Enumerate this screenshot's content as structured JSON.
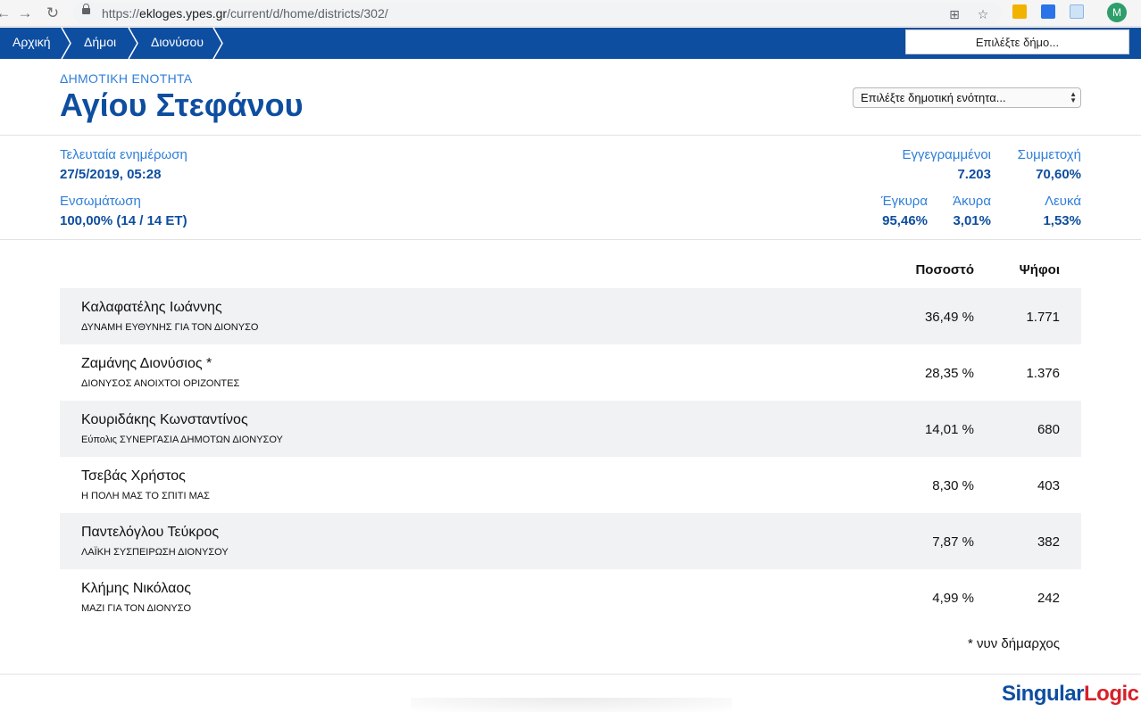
{
  "browser": {
    "url_scheme": "https://",
    "url_host": "ekloges.ypes.gr",
    "url_path": "/current/d/home/districts/302/",
    "avatar_letter": "M"
  },
  "breadcrumb": {
    "items": [
      "Αρχική",
      "Δήμοι",
      "Διονύσου"
    ]
  },
  "municipality_select": {
    "value": "Επιλέξτε δήμο..."
  },
  "header": {
    "unit_type": "Δημοτική Ενότητα",
    "unit_name": "Αγίου Στεφάνου",
    "unit_select_value": "Επιλέξτε δημοτική ενότητα..."
  },
  "stats": {
    "last_update_label": "Τελευταία ενημέρωση",
    "last_update_value": "27/5/2019, 05:28",
    "integration_label": "Ενσωμάτωση",
    "integration_value": "100,00% (14 / 14 ΕΤ)",
    "registered_label": "Εγγεγραμμένοι",
    "registered_value": "7.203",
    "turnout_label": "Συμμετοχή",
    "turnout_value": "70,60%",
    "valid_label": "Έγκυρα",
    "valid_value": "95,46%",
    "invalid_label": "Άκυρα",
    "invalid_value": "3,01%",
    "blank_label": "Λευκά",
    "blank_value": "1,53%"
  },
  "table": {
    "headers": {
      "percent": "Ποσοστό",
      "votes": "Ψήφοι"
    },
    "rows": [
      {
        "candidate": "Καλαφατέλης Ιωάννης",
        "party": "ΔΥΝΑΜΗ ΕΥΘΥΝΗΣ ΓΙΑ ΤΟΝ ΔΙΟΝΥΣΟ",
        "percent": "36,49 %",
        "votes": "1.771"
      },
      {
        "candidate": "Ζαμάνης Διονύσιος *",
        "party": "ΔΙΟΝΥΣΟΣ ΑΝΟΙΧΤΟΙ ΟΡΙΖΟΝΤΕΣ",
        "percent": "28,35 %",
        "votes": "1.376"
      },
      {
        "candidate": "Κουριδάκης Κωνσταντίνος",
        "party": "Εύπολις ΣΥΝΕΡΓΑΣΙΑ ΔΗΜΟΤΩΝ ΔΙΟΝΥΣΟΥ",
        "percent": "14,01 %",
        "votes": "680"
      },
      {
        "candidate": "Τσεβάς Χρήστος",
        "party": "Η ΠΟΛΗ ΜΑΣ ΤΟ ΣΠΙΤΙ ΜΑΣ",
        "percent": "8,30 %",
        "votes": "403"
      },
      {
        "candidate": "Παντελόγλου Τεύκρος",
        "party": "ΛΑΪΚΗ ΣΥΣΠΕΙΡΩΣΗ ΔΙΟΝΥΣΟΥ",
        "percent": "7,87 %",
        "votes": "382"
      },
      {
        "candidate": "Κλήμης Νικόλαος",
        "party": "ΜΑΖΙ ΓΙΑ ΤΟΝ ΔΙΟΝΥΣΟ",
        "percent": "4,99 %",
        "votes": "242"
      }
    ],
    "footnote": "* νυν δήμαρχος"
  },
  "footer": {
    "logo_part1": "Singular",
    "logo_part2": "Logic"
  },
  "colors": {
    "brand_blue": "#0e4ea0",
    "label_blue": "#2f7ed8",
    "logo_red": "#d72028",
    "row_shade": "#f1f2f4"
  }
}
